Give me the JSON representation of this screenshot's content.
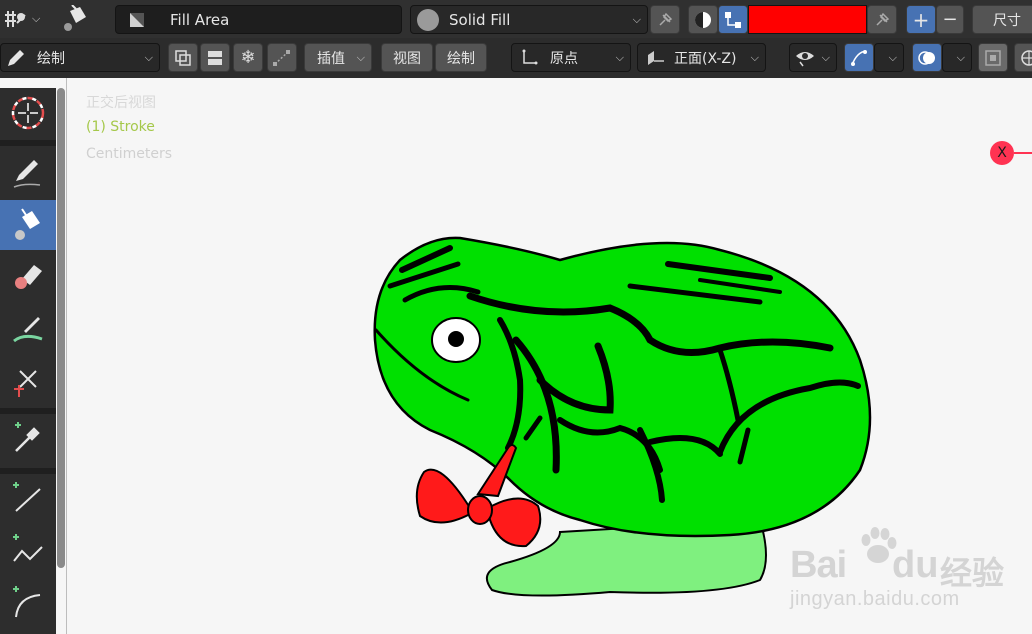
{
  "header": {
    "mode_icon": "grease-pencil-draw-icon",
    "tool_icon": "fill-bucket-icon",
    "material_field": "Fill Area",
    "fill_mode": "Solid Fill",
    "fill_color": "#ff0000",
    "plus": "+",
    "minus": "−",
    "size_label": "尺寸"
  },
  "subbar": {
    "mode_dropdown": "绘制",
    "interp_button": "插值",
    "view_tab": "视图",
    "draw_tab": "绘制",
    "origin_dropdown": "原点",
    "plane_dropdown": "正面(X-Z)"
  },
  "viewport": {
    "view_name": "正交后视图",
    "object_name": "(1) Stroke",
    "units": "Centimeters",
    "axis_label": "X"
  },
  "toolbar": {
    "tools": [
      "cursor-icon",
      "draw-pencil-icon",
      "fill-bucket-icon",
      "eraser-icon",
      "tint-brush-icon",
      "cutter-icon",
      "eyedropper-icon",
      "line-icon",
      "polyline-icon",
      "arc-icon"
    ],
    "active": "fill-bucket-icon"
  },
  "watermark": {
    "brand": "Bai",
    "brand2": "du",
    "cn": "经验",
    "url": "jingyan.baidu.com"
  },
  "colors": {
    "frog_green": "#00e000",
    "tail_green": "#7ff07f",
    "bow_red": "#ff1a1a",
    "accent_blue": "#4772b3",
    "overlay_green": "#a5c84a"
  }
}
